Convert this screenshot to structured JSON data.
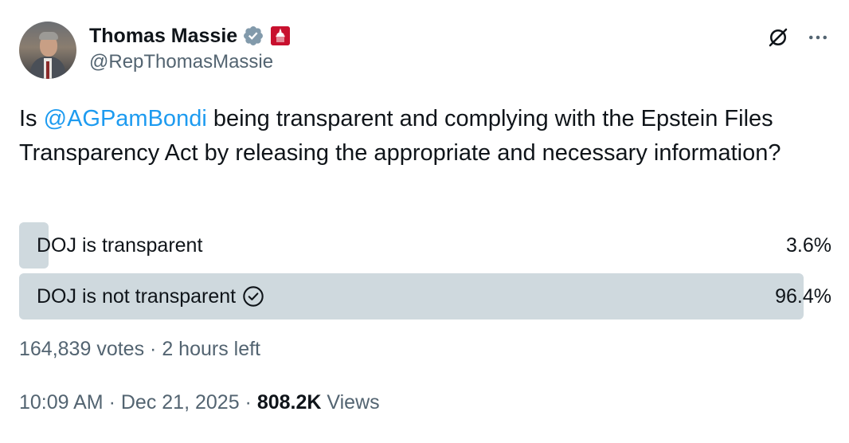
{
  "author": {
    "name": "Thomas Massie",
    "handle": "@RepThomasMassie"
  },
  "tweet": {
    "text_prefix": "Is ",
    "mention": "@AGPamBondi",
    "text_suffix": " being transparent and complying with the Epstein Files Transparency Act by releasing the appropriate and necessary information?"
  },
  "poll": {
    "options": [
      {
        "label": "DOJ is transparent",
        "percent": "3.6%",
        "value": 3.6,
        "selected": false
      },
      {
        "label": "DOJ is not transparent",
        "percent": "96.4%",
        "value": 96.4,
        "selected": true
      }
    ],
    "votes": "164,839 votes",
    "separator": "·",
    "time_left": "2 hours left"
  },
  "meta": {
    "time": "10:09 AM",
    "separator": "·",
    "date": "Dec 21, 2025",
    "views_count": "808.2K",
    "views_label": "Views"
  },
  "icons": {
    "verified": "verified-badge-icon",
    "government": "government-badge-icon",
    "grok": "grok-icon",
    "more": "more-icon",
    "check": "check-circle-icon"
  },
  "colors": {
    "accent": "#1d9bf0",
    "poll_fill": "#cfd9de",
    "secondary_text": "#536471",
    "gov_badge": "#c8102e"
  }
}
